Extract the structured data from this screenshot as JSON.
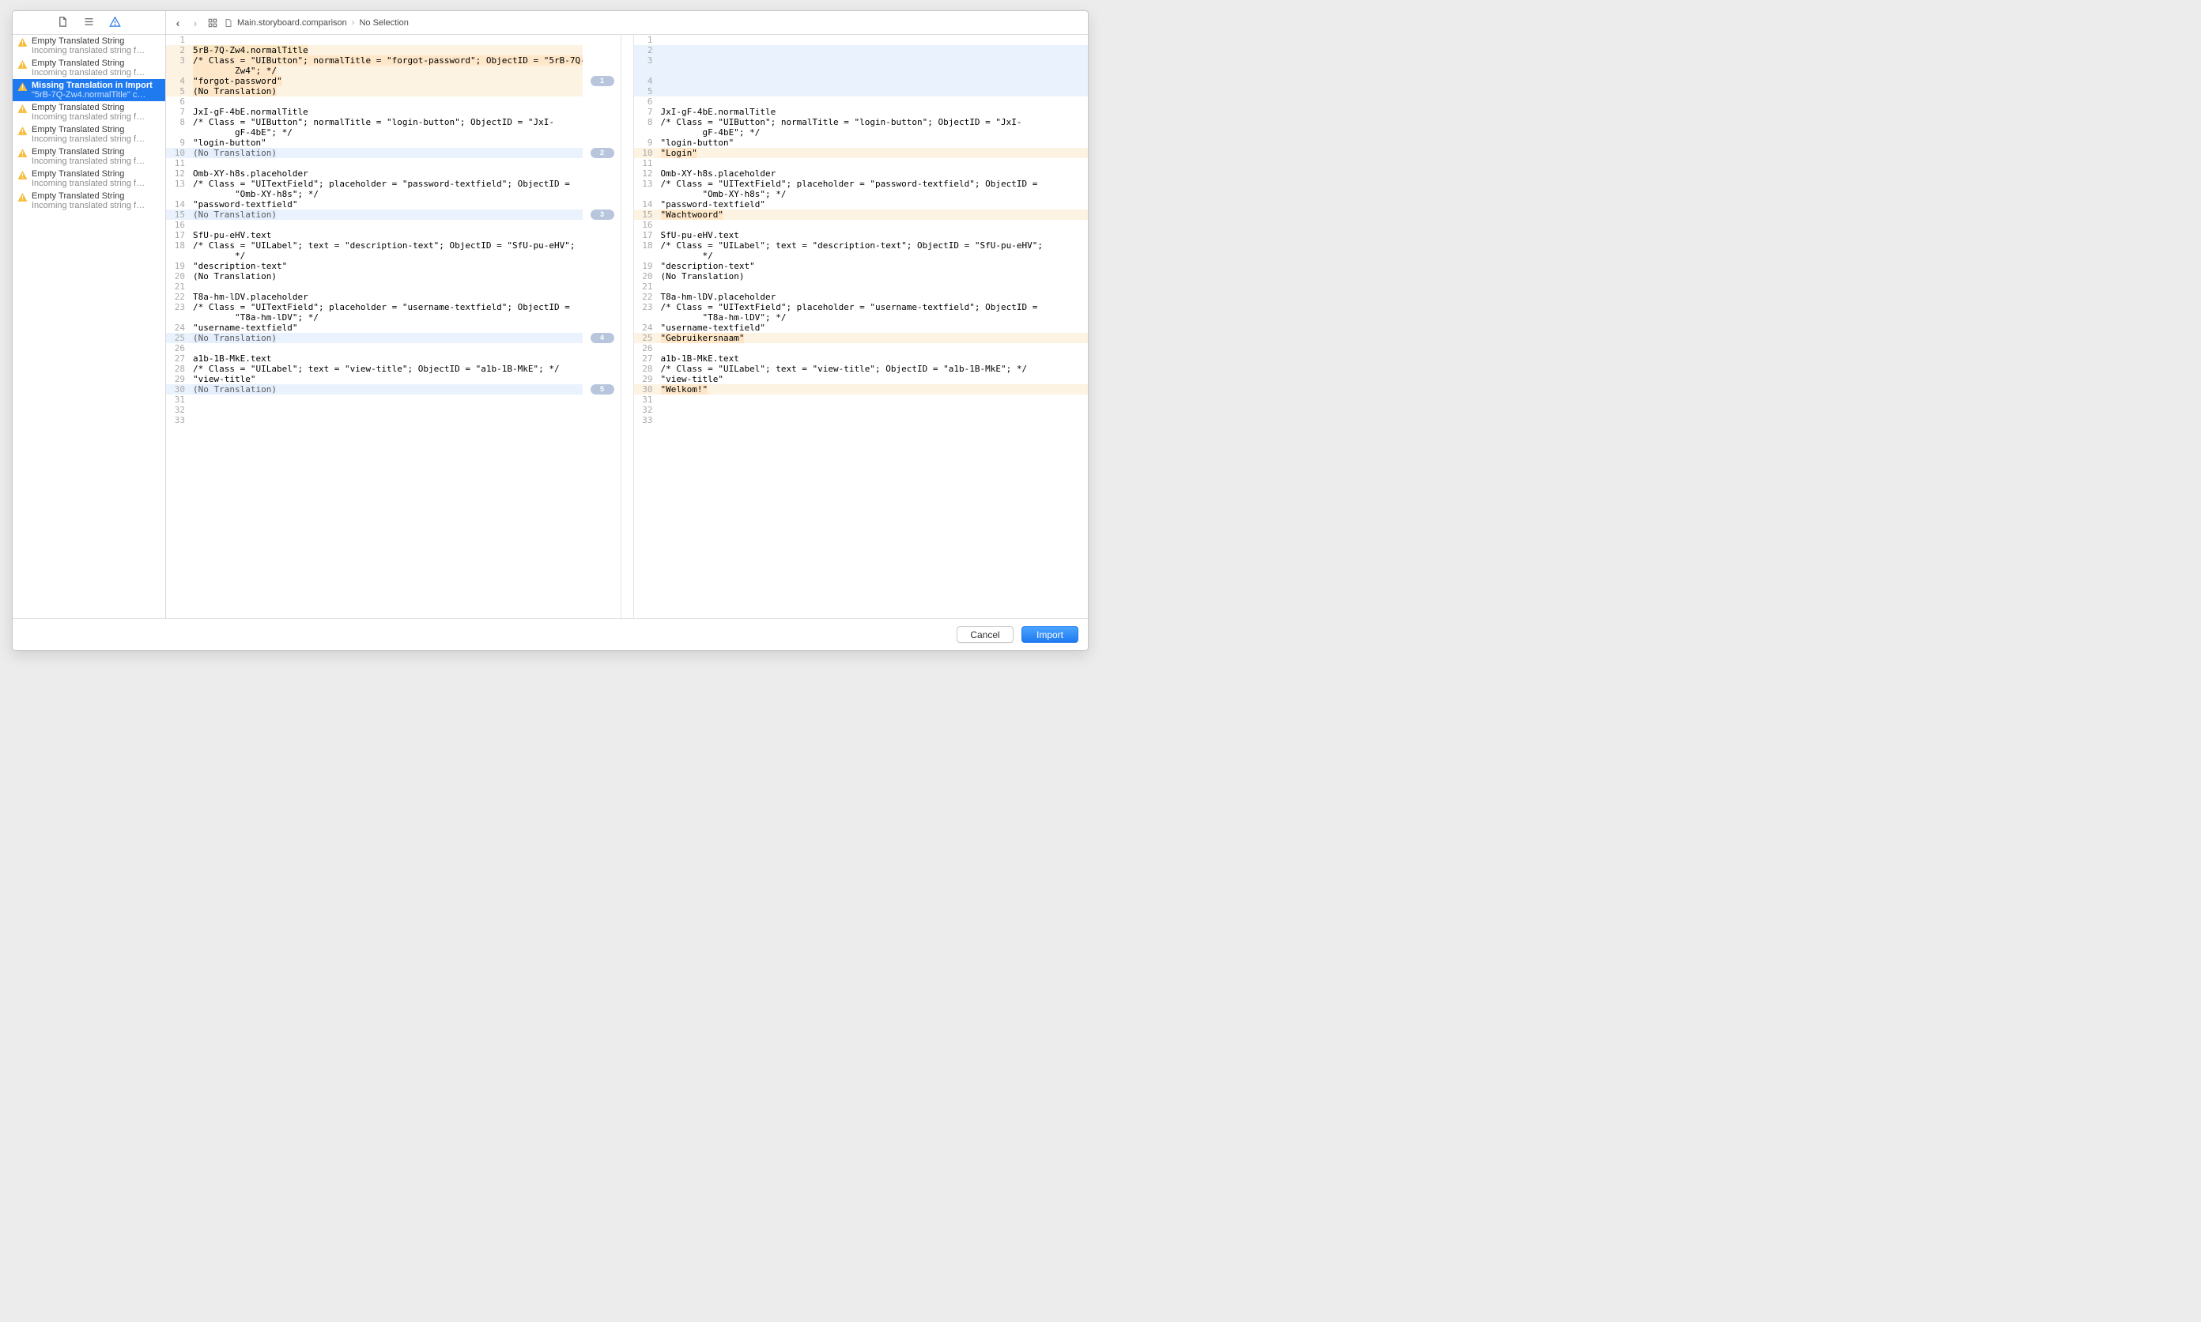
{
  "sidebar": {
    "items": [
      {
        "title": "Empty Translated String",
        "sub": "Incoming translated string f…"
      },
      {
        "title": "Empty Translated String",
        "sub": "Incoming translated string f…"
      },
      {
        "title": "Missing Translation in Import",
        "sub": "\"5rB-7Q-Zw4.normalTitle\" c…",
        "selected": true
      },
      {
        "title": "Empty Translated String",
        "sub": "Incoming translated string f…"
      },
      {
        "title": "Empty Translated String",
        "sub": "Incoming translated string f…"
      },
      {
        "title": "Empty Translated String",
        "sub": "Incoming translated string f…"
      },
      {
        "title": "Empty Translated String",
        "sub": "Incoming translated string f…"
      },
      {
        "title": "Empty Translated String",
        "sub": "Incoming translated string f…"
      }
    ]
  },
  "jumpbar": {
    "file": "Main.storyboard.comparison",
    "tail": "No Selection"
  },
  "badges": {
    "b1": "1",
    "b2": "2",
    "b3": "3",
    "b4": "4",
    "b5": "5"
  },
  "left": {
    "l1": "",
    "l2": "5rB-7Q-Zw4.normalTitle",
    "l3": "/* Class = \"UIButton\"; normalTitle = \"forgot-password\"; ObjectID = \"5rB-7Q-",
    "l3b": "        Zw4\"; */",
    "l4": "\"forgot-password\"",
    "l5": "(No Translation)",
    "l6": "",
    "l7": "JxI-gF-4bE.normalTitle",
    "l8": "/* Class = \"UIButton\"; normalTitle = \"login-button\"; ObjectID = \"JxI-",
    "l8b": "        gF-4bE\"; */",
    "l9": "\"login-button\"",
    "l10": "(No Translation)",
    "l11": "",
    "l12": "Omb-XY-h8s.placeholder",
    "l13": "/* Class = \"UITextField\"; placeholder = \"password-textfield\"; ObjectID =",
    "l13b": "        \"Omb-XY-h8s\"; */",
    "l14": "\"password-textfield\"",
    "l15": "(No Translation)",
    "l16": "",
    "l17": "SfU-pu-eHV.text",
    "l18": "/* Class = \"UILabel\"; text = \"description-text\"; ObjectID = \"SfU-pu-eHV\";",
    "l18b": "        */",
    "l19": "\"description-text\"",
    "l20": "(No Translation)",
    "l21": "",
    "l22": "T8a-hm-lDV.placeholder",
    "l23": "/* Class = \"UITextField\"; placeholder = \"username-textfield\"; ObjectID =",
    "l23b": "        \"T8a-hm-lDV\"; */",
    "l24": "\"username-textfield\"",
    "l25": "(No Translation)",
    "l26": "",
    "l27": "a1b-1B-MkE.text",
    "l28": "/* Class = \"UILabel\"; text = \"view-title\"; ObjectID = \"a1b-1B-MkE\"; */",
    "l29": "\"view-title\"",
    "l30": "(No Translation)",
    "l31": "",
    "l32": "",
    "l33": ""
  },
  "leftNums": {
    "n1": "1",
    "n2": "2",
    "n3": "3",
    "n4": "4",
    "n5": "5",
    "n6": "6",
    "n7": "7",
    "n8": "8",
    "n9": "9",
    "n10": "10",
    "n11": "11",
    "n12": "12",
    "n13": "13",
    "n14": "14",
    "n15": "15",
    "n16": "16",
    "n17": "17",
    "n18": "18",
    "n19": "19",
    "n20": "20",
    "n21": "21",
    "n22": "22",
    "n23": "23",
    "n24": "24",
    "n25": "25",
    "n26": "26",
    "n27": "27",
    "n28": "28",
    "n29": "29",
    "n30": "30",
    "n31": "31",
    "n32": "32",
    "n33": "33"
  },
  "right": {
    "r1": "",
    "r2": "",
    "r3": "",
    "r4": "",
    "r5": "",
    "r6": "",
    "r7": "JxI-gF-4bE.normalTitle",
    "r8": "/* Class = \"UIButton\"; normalTitle = \"login-button\"; ObjectID = \"JxI-",
    "r8b": "        gF-4bE\"; */",
    "r9": "\"login-button\"",
    "r10": "\"Login\"",
    "r11": "",
    "r12": "Omb-XY-h8s.placeholder",
    "r13": "/* Class = \"UITextField\"; placeholder = \"password-textfield\"; ObjectID =",
    "r13b": "        \"Omb-XY-h8s\"; */",
    "r14": "\"password-textfield\"",
    "r15": "\"Wachtwoord\"",
    "r16": "",
    "r17": "SfU-pu-eHV.text",
    "r18": "/* Class = \"UILabel\"; text = \"description-text\"; ObjectID = \"SfU-pu-eHV\";",
    "r18b": "        */",
    "r19": "\"description-text\"",
    "r20": "(No Translation)",
    "r21": "",
    "r22": "T8a-hm-lDV.placeholder",
    "r23": "/* Class = \"UITextField\"; placeholder = \"username-textfield\"; ObjectID =",
    "r23b": "        \"T8a-hm-lDV\"; */",
    "r24": "\"username-textfield\"",
    "r25": "\"Gebruikersnaam\"",
    "r26": "",
    "r27": "a1b-1B-MkE.text",
    "r28": "/* Class = \"UILabel\"; text = \"view-title\"; ObjectID = \"a1b-1B-MkE\"; */",
    "r29": "\"view-title\"",
    "r30": "\"Welkom!\"",
    "r31": "",
    "r32": "",
    "r33": ""
  },
  "rightNums": {
    "n1": "1",
    "n2": "2",
    "n3": "3",
    "n4": "4",
    "n5": "5",
    "n6": "6",
    "n7": "7",
    "n8": "8",
    "n9": "9",
    "n10": "10",
    "n11": "11",
    "n12": "12",
    "n13": "13",
    "n14": "14",
    "n15": "15",
    "n16": "16",
    "n17": "17",
    "n18": "18",
    "n19": "19",
    "n20": "20",
    "n21": "21",
    "n22": "22",
    "n23": "23",
    "n24": "24",
    "n25": "25",
    "n26": "26",
    "n27": "27",
    "n28": "28",
    "n29": "29",
    "n30": "30",
    "n31": "31",
    "n32": "32",
    "n33": "33"
  },
  "buttons": {
    "cancel": "Cancel",
    "import": "Import"
  }
}
